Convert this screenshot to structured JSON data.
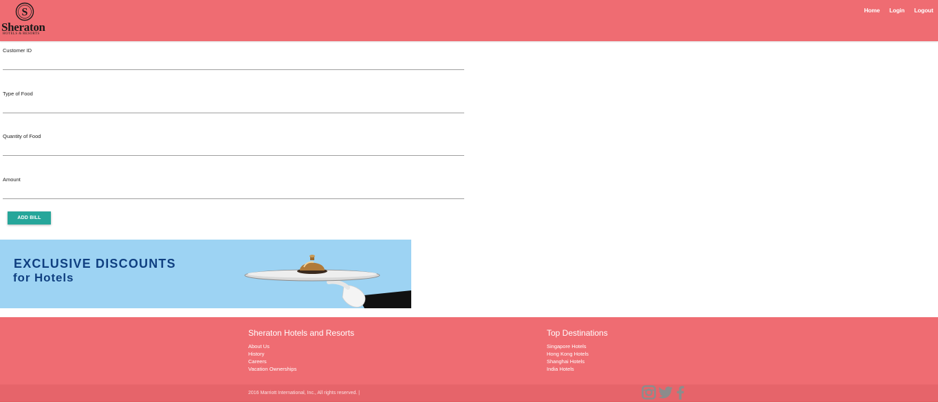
{
  "header": {
    "logo_word": "Sheraton",
    "logo_sub": "HOTELS & RESORTS",
    "nav": [
      "Home",
      "Login",
      "Logout"
    ]
  },
  "form": {
    "fields": [
      {
        "label": "Customer ID",
        "value": ""
      },
      {
        "label": "Type of Food",
        "value": ""
      },
      {
        "label": "Quantity of Food",
        "value": ""
      },
      {
        "label": "Amount",
        "value": ""
      }
    ],
    "submit_label": "ADD BILL"
  },
  "banner": {
    "line1": "EXCLUSIVE DISCOUNTS",
    "line2": "for Hotels"
  },
  "footer": {
    "col1": {
      "title": "Sheraton Hotels and Resorts",
      "links": [
        "About Us",
        "History",
        "Careers",
        "Vacation Ownerships"
      ]
    },
    "col2": {
      "title": "Top Destinations",
      "links": [
        "Singapore Hotels",
        "Hong Kong Hotels",
        "Shanghai Hotels",
        "India Hotels"
      ]
    },
    "copyright": "2016 Marriott International, Inc., All rights reserved. |",
    "social_icons": [
      "instagram-icon",
      "twitter-icon",
      "facebook-icon"
    ]
  },
  "colors": {
    "header_bg": "#ef6c72",
    "button_bg": "#26a69a",
    "banner_bg": "#9dd3f3",
    "banner_text": "#0f3f80"
  }
}
